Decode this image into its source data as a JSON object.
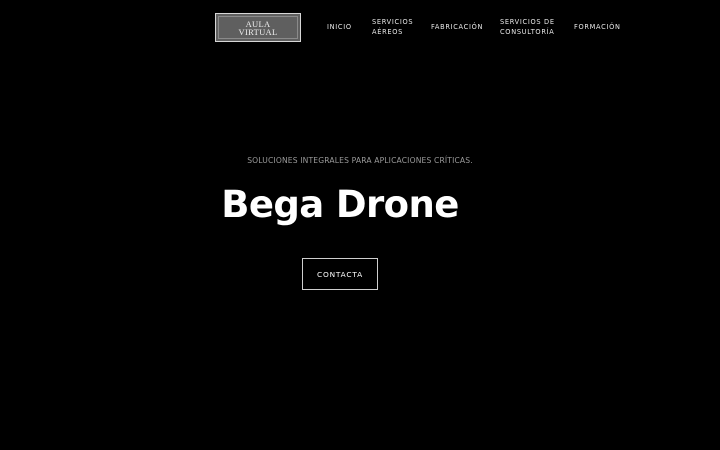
{
  "header": {
    "logo": {
      "line1": "AULA",
      "line2": "VIRTUAL"
    },
    "nav": [
      {
        "line1": "INICIO",
        "line2": ""
      },
      {
        "line1": "SERVICIOS",
        "line2": "AÉREOS"
      },
      {
        "line1": "FABRICACIÓN",
        "line2": ""
      },
      {
        "line1": "SERVICIOS DE",
        "line2": "CONSULTORÍA"
      },
      {
        "line1": "FORMACIÓN",
        "line2": ""
      }
    ]
  },
  "hero": {
    "tagline": "SOLUCIONES INTEGRALES PARA APLICACIONES CRÍTICAS.",
    "title": "Bega Drone",
    "cta_label": "CONTACTA"
  },
  "colors": {
    "background": "#000000",
    "text": "#ffffff",
    "tagline": "#9a9a9a",
    "logo_bg": "#5f5f5f"
  }
}
